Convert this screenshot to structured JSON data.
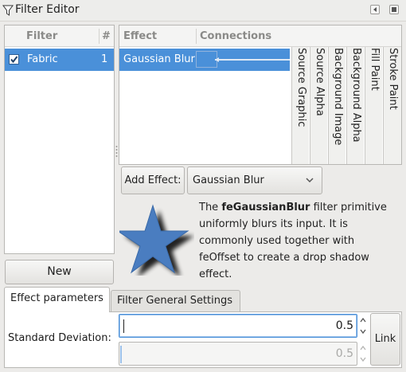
{
  "window": {
    "title": "Filter Editor"
  },
  "filter_list": {
    "columns": {
      "filter": "Filter",
      "count": "#"
    },
    "items": [
      {
        "name": "Fabric",
        "count": "1",
        "checked": true
      }
    ],
    "new_button": "New"
  },
  "effects": {
    "columns": {
      "effect": "Effect",
      "connections": "Connections"
    },
    "items": [
      {
        "name": "Gaussian Blur"
      }
    ],
    "inputs": [
      "Source Graphic",
      "Source Alpha",
      "Background Image",
      "Background Alpha",
      "Fill Paint",
      "Stroke Paint"
    ]
  },
  "add_effect": {
    "button": "Add Effect:",
    "selected": "Gaussian Blur"
  },
  "description": {
    "prefix": "The ",
    "primitive": "feGaussianBlur",
    "rest": " filter primitive uniformly blurs its input.  It is commonly used together with feOffset to create a drop shadow effect."
  },
  "tabs": [
    {
      "label": "Effect parameters",
      "active": true
    },
    {
      "label": "Filter General Settings",
      "active": false
    }
  ],
  "params": {
    "std_dev_label": "Standard Deviation:",
    "value1": "0.5",
    "value2": "0.5",
    "link_button": "Link"
  },
  "colors": {
    "selection": "#4a90d9",
    "star": "#4a7dc0"
  }
}
